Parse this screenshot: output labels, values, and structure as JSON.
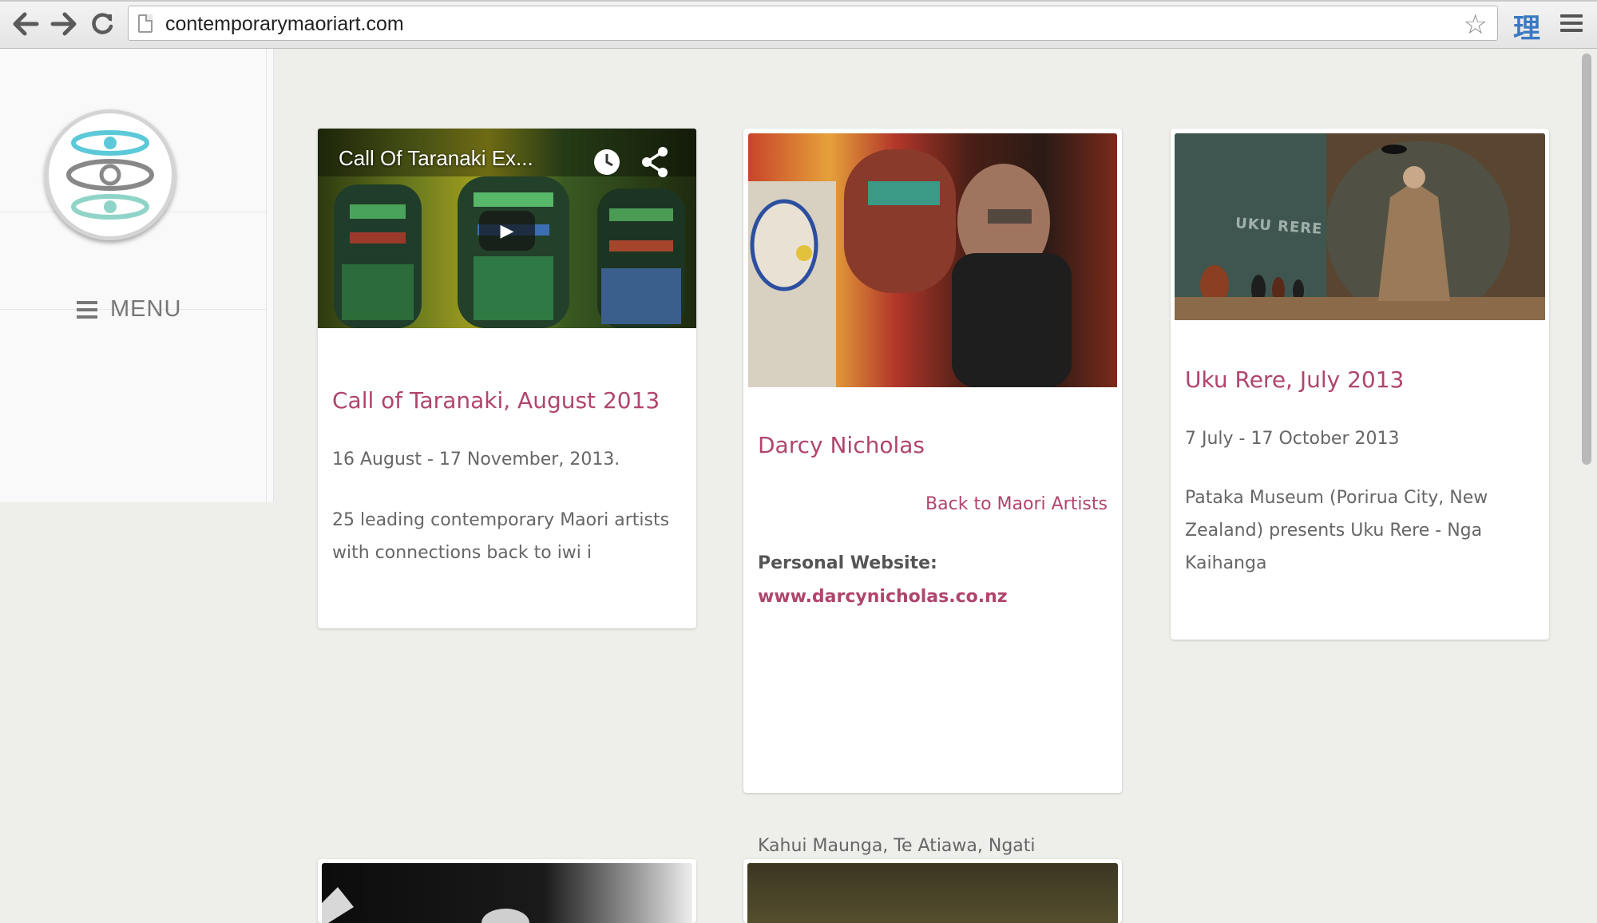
{
  "browser": {
    "url": "contemporarymaoriart.com",
    "ext_icon_char": "理",
    "icons": [
      "back-arrow-icon",
      "forward-arrow-icon",
      "reload-icon",
      "page-icon",
      "star-icon",
      "chrome-menu-icon"
    ]
  },
  "sidebar": {
    "menu_label": "MENU"
  },
  "cards": [
    {
      "video_title": "Call Of Taranaki Ex...",
      "title": "Call of Taranaki, August 2013",
      "date": "16 August - 17 November, 2013.",
      "excerpt": "25 leading contemporary Maori artists with connections back to iwi i"
    },
    {
      "title": "Darcy Nicholas",
      "back_link": "Back to Maori Artists",
      "website_label": "Personal Website:",
      "website_url": "www.darcynicholas.co.nz",
      "tribes": "Kahui Maunga, Te Atiawa, Ngati"
    },
    {
      "title": "Uku Rere, July 2013",
      "date": "7 July - 17 October 2013",
      "excerpt": "Pataka Museum (Porirua City, New Zealand) presents Uku Rere - Nga Kaihanga",
      "photo_sign": "UKU RERE"
    }
  ],
  "colors": {
    "accent": "#b0456e",
    "background": "#eeeeea",
    "card": "#ffffff",
    "chrome_icon_blue": "#3b79c2"
  }
}
